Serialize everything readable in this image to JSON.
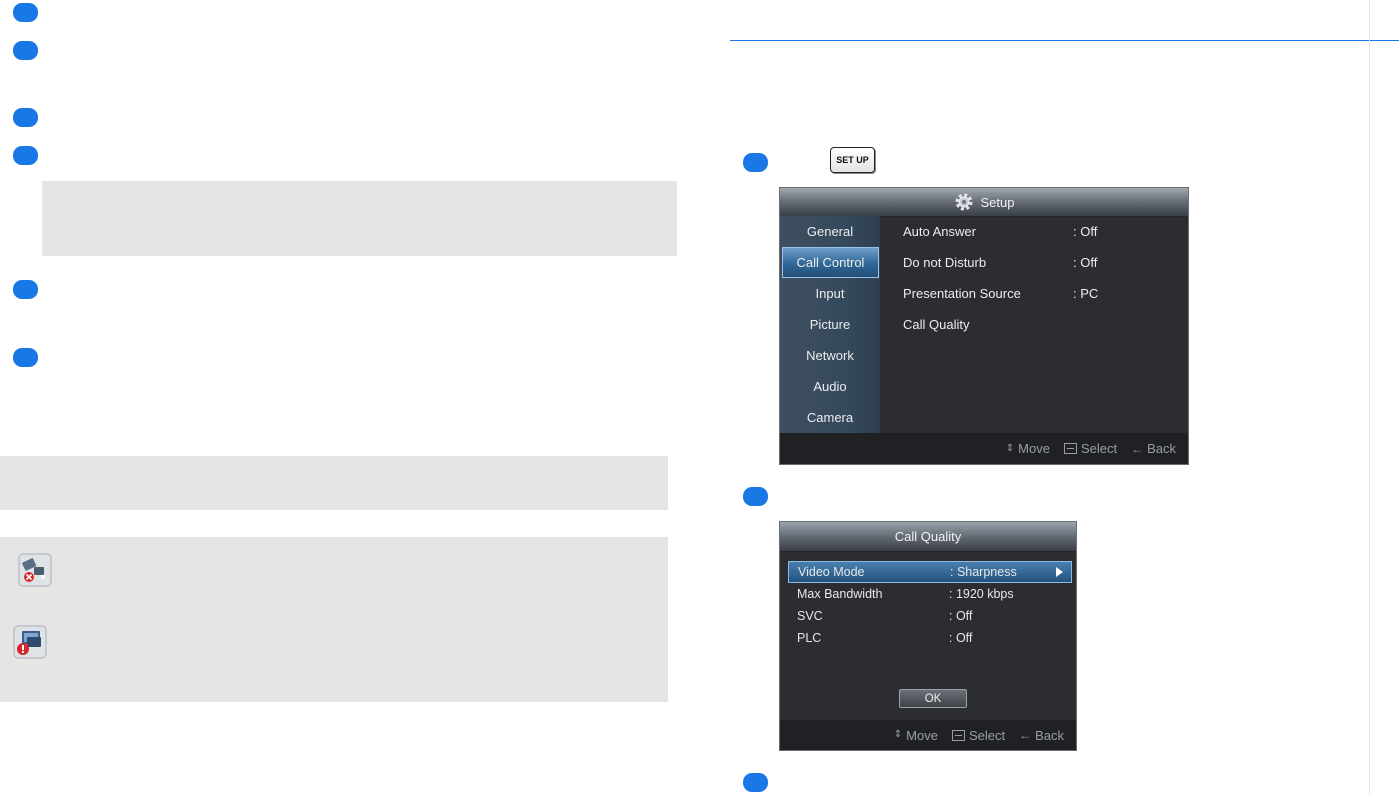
{
  "setup_key_label": "SET UP",
  "setup_screen": {
    "title": "Setup",
    "menu": [
      "General",
      "Call Control",
      "Input",
      "Picture",
      "Network",
      "Audio",
      "Camera"
    ],
    "selected_menu": "Call Control",
    "rows": [
      {
        "label": "Auto Answer",
        "value": ": Off"
      },
      {
        "label": "Do not Disturb",
        "value": ": Off"
      },
      {
        "label": "Presentation Source",
        "value": ": PC"
      },
      {
        "label": "Call Quality",
        "value": ""
      }
    ],
    "footer": {
      "move": "Move",
      "select": "Select",
      "back": "Back"
    }
  },
  "call_quality_screen": {
    "title": "Call Quality",
    "rows": [
      {
        "label": "Video Mode",
        "value": ": Sharpness"
      },
      {
        "label": "Max Bandwidth",
        "value": ": 1920 kbps"
      },
      {
        "label": "SVC",
        "value": ": Off"
      },
      {
        "label": "PLC",
        "value": ": Off"
      }
    ],
    "ok_label": "OK",
    "footer": {
      "move": "Move",
      "select": "Select",
      "back": "Back"
    }
  },
  "colors": {
    "accent": "#1a78e6",
    "note_box": "#e5e5e5"
  }
}
